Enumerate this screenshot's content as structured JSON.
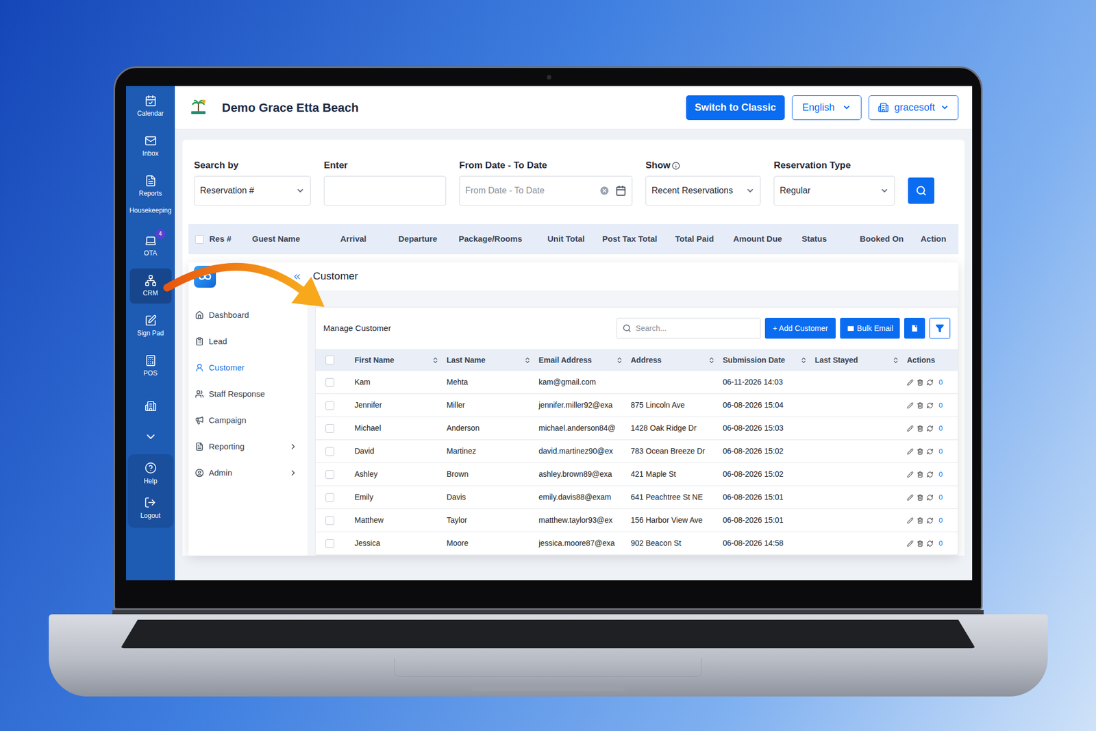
{
  "header": {
    "title": "Demo Grace Etta Beach",
    "switch_button": "Switch to Classic",
    "language": "English",
    "account": "gracesoft"
  },
  "nav_rail": {
    "items": [
      {
        "label": "Calendar",
        "kind": "item",
        "selected": false
      },
      {
        "label": "Inbox",
        "kind": "item",
        "selected": false
      },
      {
        "label": "Reports",
        "kind": "item",
        "selected": false
      },
      {
        "label": "Housekeeping",
        "kind": "label",
        "selected": false
      },
      {
        "label": "OTA",
        "kind": "item",
        "selected": false,
        "badge": "4"
      },
      {
        "label": "CRM",
        "kind": "item",
        "selected": true
      },
      {
        "label": "Sign Pad",
        "kind": "item",
        "selected": false
      },
      {
        "label": "POS",
        "kind": "item",
        "selected": false
      },
      {
        "kind": "icon",
        "selected": false
      }
    ],
    "bottom": [
      {
        "label": "Help"
      },
      {
        "label": "Logout"
      }
    ]
  },
  "filters": [
    {
      "label": "Search by",
      "kind": "select",
      "value": "Reservation #"
    },
    {
      "label": "Enter",
      "kind": "input",
      "value": ""
    },
    {
      "label": "From Date - To Date",
      "kind": "date",
      "placeholder": "From Date - To Date"
    },
    {
      "label": "Show",
      "kind": "select",
      "value": "Recent Reservations",
      "info": true
    },
    {
      "label": "Reservation Type",
      "kind": "select",
      "value": "Regular"
    }
  ],
  "reservations_table": {
    "select_all": false,
    "columns": [
      "Res #",
      "Guest Name",
      "Arrival",
      "Departure",
      "Package/Rooms",
      "Unit Total",
      "Post Tax Total",
      "Total Paid",
      "Amount Due",
      "Status",
      "Booked On",
      "Action"
    ]
  },
  "crm": {
    "title": "Customer",
    "sidebar": [
      {
        "label": "Dashboard",
        "selected": false,
        "submenu": false
      },
      {
        "label": "Lead",
        "selected": false,
        "submenu": false
      },
      {
        "label": "Customer",
        "selected": true,
        "submenu": false
      },
      {
        "label": "Staff Response",
        "selected": false,
        "submenu": false
      },
      {
        "label": "Campaign",
        "selected": false,
        "submenu": false
      },
      {
        "label": "Reporting",
        "selected": false,
        "submenu": true
      },
      {
        "label": "Admin",
        "selected": false,
        "submenu": true
      }
    ],
    "card": {
      "title": "Manage Customer",
      "search_placeholder": "Search...",
      "add_button": "+ Add Customer",
      "bulk_button": "Bulk Email"
    },
    "table": {
      "select_all": false,
      "columns": [
        {
          "label": "First Name",
          "sortable": true
        },
        {
          "label": "Last Name",
          "sortable": true
        },
        {
          "label": "Email Address",
          "sortable": true
        },
        {
          "label": "Address",
          "sortable": true
        },
        {
          "label": "Submission Date",
          "sortable": true
        },
        {
          "label": "Last Stayed",
          "sortable": true
        },
        {
          "label": "Actions",
          "sortable": false
        }
      ],
      "rows": [
        {
          "first": "Kam",
          "last": "Mehta",
          "email": "kam@gmail.com",
          "address": "",
          "submitted": "06-11-2026 14:03",
          "last_stayed": "",
          "count": "0",
          "checked": false
        },
        {
          "first": "Jennifer",
          "last": "Miller",
          "email": "jennifer.miller92@exa",
          "address": "875 Lincoln Ave",
          "submitted": "06-08-2026 15:04",
          "last_stayed": "",
          "count": "0",
          "checked": false
        },
        {
          "first": "Michael",
          "last": "Anderson",
          "email": "michael.anderson84@",
          "address": "1428 Oak Ridge Dr",
          "submitted": "06-08-2026 15:03",
          "last_stayed": "",
          "count": "0",
          "checked": false
        },
        {
          "first": "David",
          "last": "Martinez",
          "email": "david.martinez90@ex",
          "address": "783 Ocean Breeze Dr",
          "submitted": "06-08-2026 15:02",
          "last_stayed": "",
          "count": "0",
          "checked": false
        },
        {
          "first": "Ashley",
          "last": "Brown",
          "email": "ashley.brown89@exa",
          "address": "421 Maple St",
          "submitted": "06-08-2026 15:02",
          "last_stayed": "",
          "count": "0",
          "checked": false
        },
        {
          "first": "Emily",
          "last": "Davis",
          "email": "emily.davis88@exam",
          "address": "641 Peachtree St NE",
          "submitted": "06-08-2026 15:01",
          "last_stayed": "",
          "count": "0",
          "checked": false
        },
        {
          "first": "Matthew",
          "last": "Taylor",
          "email": "matthew.taylor93@ex",
          "address": "156 Harbor View Ave",
          "submitted": "06-08-2026 15:01",
          "last_stayed": "",
          "count": "0",
          "checked": false
        },
        {
          "first": "Jessica",
          "last": "Moore",
          "email": "jessica.moore87@exa",
          "address": "902 Beacon St",
          "submitted": "06-08-2026 14:58",
          "last_stayed": "",
          "count": "0",
          "checked": false
        }
      ]
    }
  }
}
